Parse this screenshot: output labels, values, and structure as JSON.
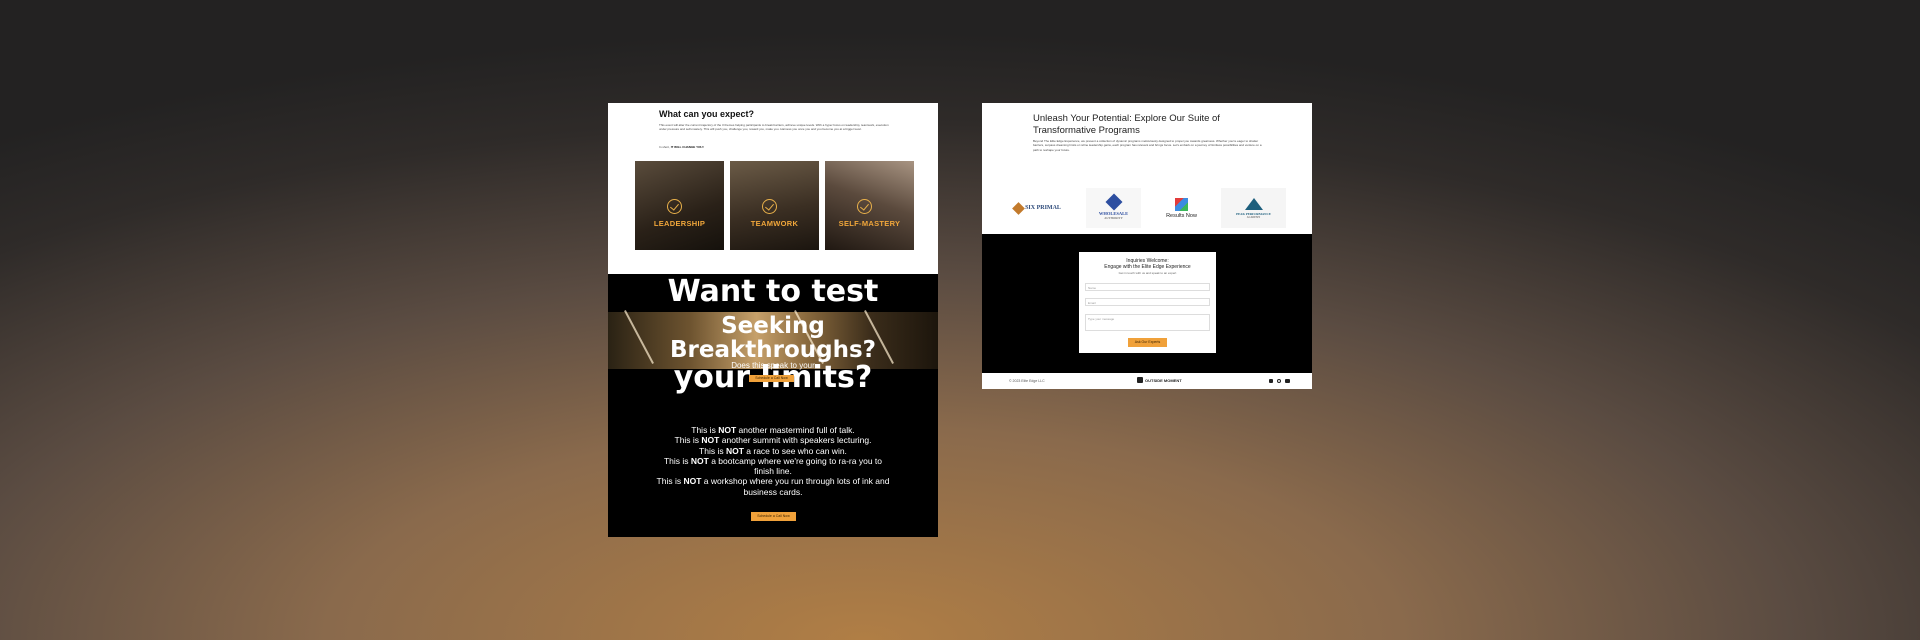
{
  "left": {
    "heading": "What can you expect?",
    "intro": "This event will alter the current trajectory of the 3 themes helping participants to break barriers, achieve unique levels. With a hyper focus on leadership, teamwork, execution under pressure and self-mastery. This will push you, challenge you, reward you, make you. Harness you once you and you become you at a bigger level.",
    "short_prefix": "In short,",
    "short_bold": "IT WILL CHANGE YOU!",
    "cards": [
      {
        "label": "LEADERSHIP",
        "color": "#3a3128"
      },
      {
        "label": "TEAMWORK",
        "color": "#463a2c"
      },
      {
        "label": "SELF-MASTERY",
        "color": "#4a3e34"
      }
    ],
    "want_line1": "Want to test",
    "seeking_line1": "Seeking",
    "seeking_line2": "Breakthroughs?",
    "does_text": "Does this speak to your",
    "limits_line": "your limits?",
    "cta_small": "Schedule a Call Now",
    "not_lines": [
      {
        "pre": "This is ",
        "bold": "NOT",
        "post": " another mastermind full of talk."
      },
      {
        "pre": "This is ",
        "bold": "NOT",
        "post": " another summit with speakers lecturing."
      },
      {
        "pre": "This is ",
        "bold": "NOT",
        "post": " a race to see who can win."
      },
      {
        "pre": "This is ",
        "bold": "NOT",
        "post": " a bootcamp where we're going to ra-ra you to finish line."
      },
      {
        "pre": "This is ",
        "bold": "NOT",
        "post": " a workshop where you run through lots of ink and business cards."
      }
    ],
    "cta_bottom": "Schedule a Call Now"
  },
  "right": {
    "heading": "Unleash Your Potential: Explore Our Suite of Transformative Programs",
    "paragraph": "Beyond The Elite Edge Experience, we present a collection of dynamic programs meticulously designed to propel you towards greatness. Whether you're eager to shatter barriers, surpass dreaming limits or refine leadership gains, each program has relevant and brings focus. Let's embark on a journey of limitless possibilities and venture on a path to reshape your future.",
    "logos": [
      {
        "name": "SIX PRIMAL",
        "icon": "six-primal-logo",
        "color": "#c27a2c"
      },
      {
        "name": "WHOLESALE",
        "sub": "AUTHORITY",
        "icon": "wholesale-logo",
        "color": "#2d4ea0"
      },
      {
        "name": "Results Now",
        "icon": "results-now-logo",
        "color": "#222222"
      },
      {
        "name": "PEAK PERFORMANCE",
        "sub": "ACADEMY",
        "icon": "peak-performance-logo",
        "color": "#1d5f7d"
      }
    ],
    "form": {
      "title1": "Inquiries Welcome:",
      "title2": "Engage with the Elite Edge Experience",
      "note": "Get in touch with us and speak to an expert",
      "name_ph": "Name",
      "email_ph": "Email",
      "message_ph": "Type your message",
      "button": "Ask Our Experts"
    },
    "footer": {
      "copyright": "© 2023 Elite Edge LLC",
      "brand": "OUTSIDE MOMENT"
    }
  },
  "colors": {
    "accent": "#f0a13a",
    "black": "#000000",
    "white": "#ffffff"
  }
}
